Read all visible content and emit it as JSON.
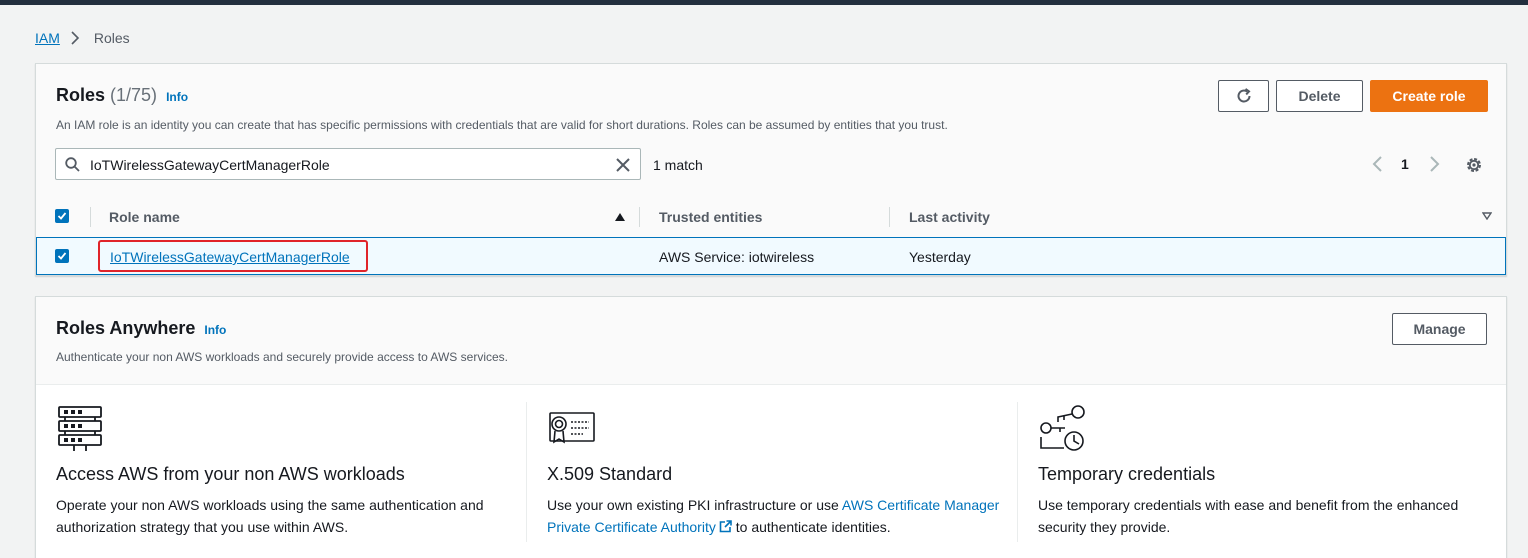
{
  "breadcrumb": {
    "root": "IAM",
    "current": "Roles"
  },
  "roles": {
    "title": "Roles",
    "count": "(1/75)",
    "info": "Info",
    "description": "An IAM role is an identity you can create that has specific permissions with credentials that are valid for short durations. Roles can be assumed by entities that you trust.",
    "buttons": {
      "delete": "Delete",
      "create": "Create role"
    },
    "search_value": "IoTWirelessGatewayCertManagerRole",
    "match_text": "1 match",
    "page": "1",
    "columns": {
      "role_name": "Role name",
      "trusted": "Trusted entities",
      "activity": "Last activity"
    },
    "rows": [
      {
        "role_name": "IoTWirelessGatewayCertManagerRole",
        "trusted": "AWS Service: iotwireless",
        "activity": "Yesterday",
        "selected": true
      }
    ]
  },
  "anywhere": {
    "title": "Roles Anywhere",
    "info": "Info",
    "description": "Authenticate your non AWS workloads and securely provide access to AWS services.",
    "manage": "Manage",
    "features": [
      {
        "icon": "server-stack-icon",
        "title": "Access AWS from your non AWS workloads",
        "text": "Operate your non AWS workloads using the same authentication and authorization strategy that you use within AWS."
      },
      {
        "icon": "certificate-icon",
        "title": "X.509 Standard",
        "text_before": "Use your own existing PKI infrastructure or use ",
        "link": "AWS Certificate Manager Private Certificate Authority",
        "text_after": " to authenticate identities."
      },
      {
        "icon": "keys-clock-icon",
        "title": "Temporary credentials",
        "text": "Use temporary credentials with ease and benefit from the enhanced security they provide."
      }
    ]
  },
  "colors": {
    "link": "#0073bb",
    "primary": "#ec7211",
    "highlight": "#e0242a",
    "topbar": "#232f3e"
  }
}
